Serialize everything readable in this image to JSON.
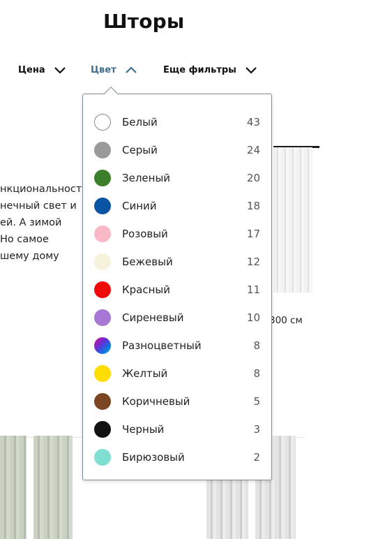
{
  "page": {
    "title": "Шторы"
  },
  "filters": [
    {
      "label": "Цена",
      "state": "collapsed"
    },
    {
      "label": "Цвет",
      "state": "expanded",
      "accent": "#3f6f8f"
    },
    {
      "label": "Еще фильтры",
      "state": "collapsed"
    }
  ],
  "background": {
    "text_lines": [
      "нкциональност",
      "нечный свет и",
      "ей. А зимой",
      "Но самое",
      "шему дому"
    ],
    "size_label": "300 см"
  },
  "color_filter": {
    "options": [
      {
        "name": "Белый",
        "count": "43",
        "swatch": "#ffffff"
      },
      {
        "name": "Серый",
        "count": "24",
        "swatch": "#9a9a9a"
      },
      {
        "name": "Зеленый",
        "count": "20",
        "swatch": "#3c7f2a"
      },
      {
        "name": "Синий",
        "count": "18",
        "swatch": "#0a55a3"
      },
      {
        "name": "Розовый",
        "count": "17",
        "swatch": "#f9b8c6"
      },
      {
        "name": "Бежевый",
        "count": "12",
        "swatch": "#f6f2dc"
      },
      {
        "name": "Красный",
        "count": "11",
        "swatch": "#ee0a0a"
      },
      {
        "name": "Сиреневый",
        "count": "10",
        "swatch": "#a678d4"
      },
      {
        "name": "Разноцветный",
        "count": "8",
        "swatch": "multicolor"
      },
      {
        "name": "Желтый",
        "count": "8",
        "swatch": "#ffdd00"
      },
      {
        "name": "Коричневый",
        "count": "5",
        "swatch": "#7a4520"
      },
      {
        "name": "Черный",
        "count": "3",
        "swatch": "#111111"
      },
      {
        "name": "Бирюзовый",
        "count": "2",
        "swatch": "#7fdfd2"
      }
    ]
  }
}
